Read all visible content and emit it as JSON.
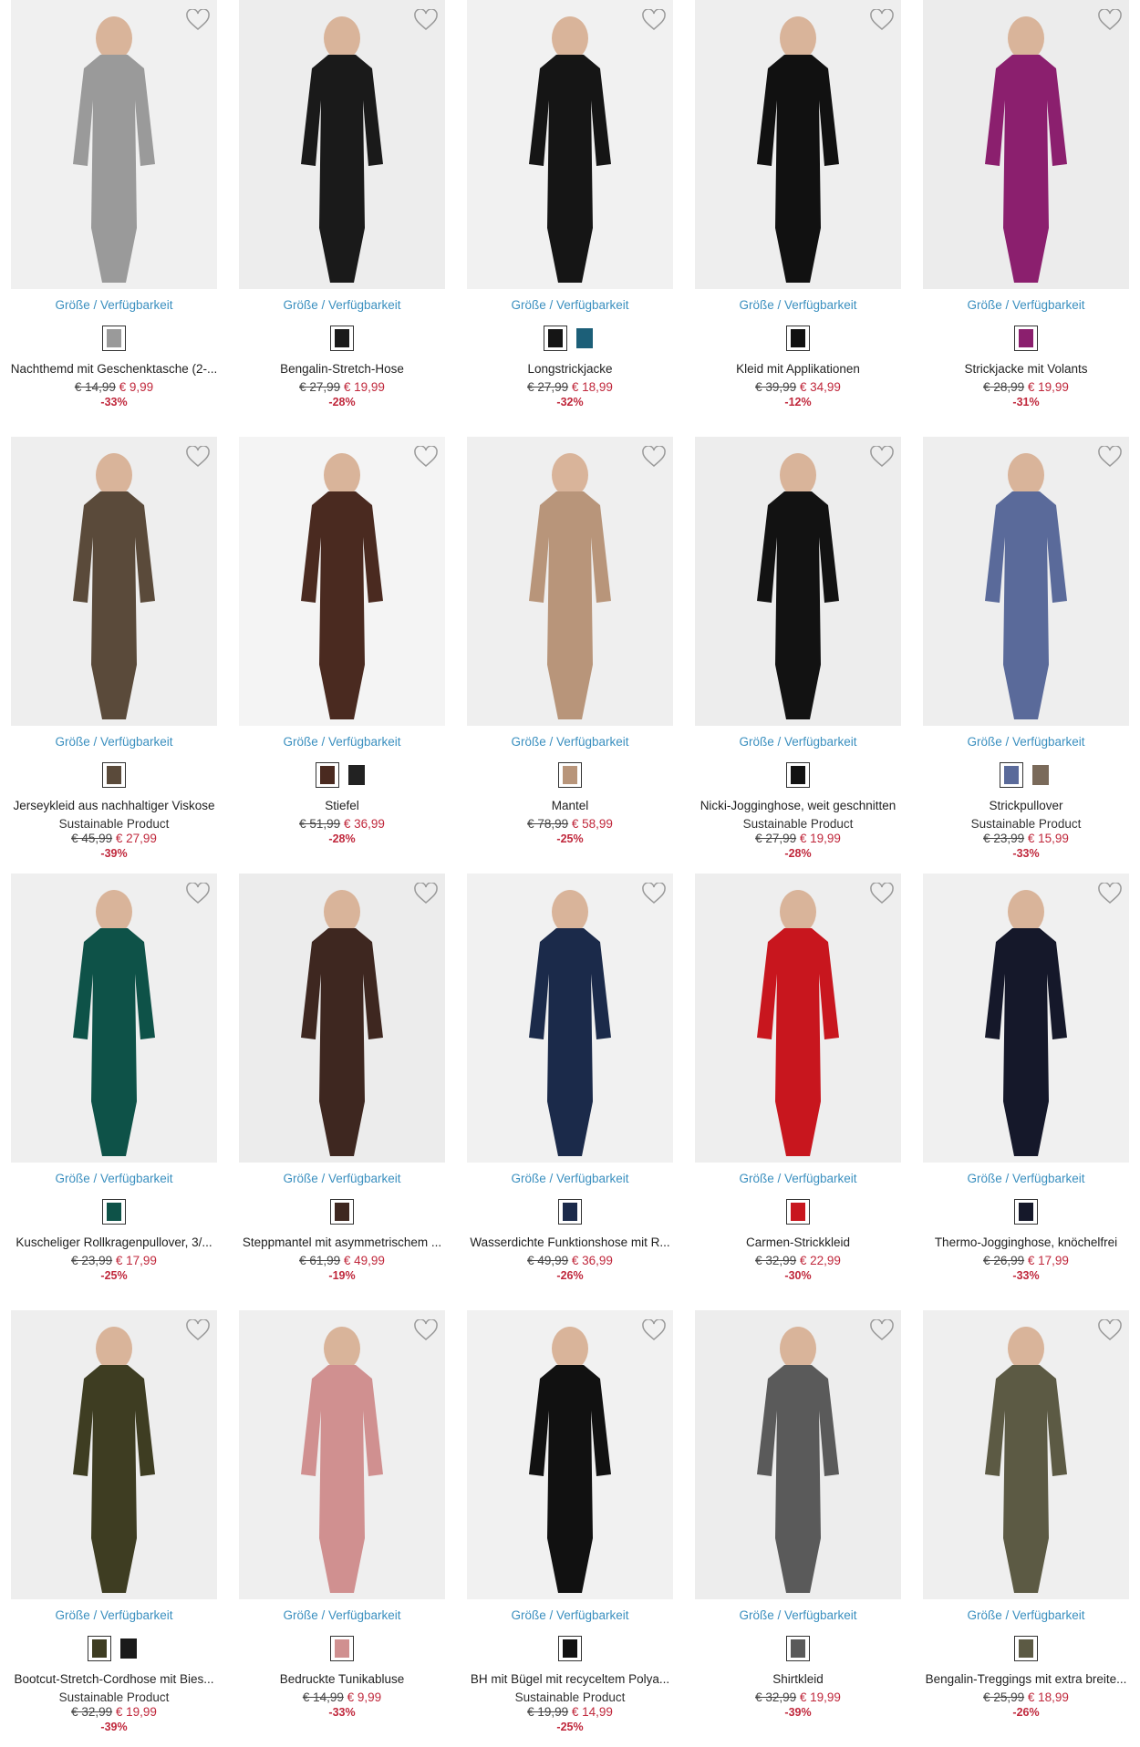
{
  "colors": {
    "link": "#3a8fbf",
    "sale": "#c0283c",
    "text": "#222222",
    "image_bg": "#efefef"
  },
  "common": {
    "size_link": "Größe / Verfügbarkeit",
    "wishlist_icon": "heart-outline-icon"
  },
  "products": [
    {
      "name": "Nachthemd mit Geschenktasche (2-...",
      "sustainable": "",
      "old_price": "€ 14,99",
      "new_price": "€ 9,99",
      "discount": "-33%",
      "image_bg": "#f0f0f0",
      "garment_color": "#9a9a9a",
      "swatches": [
        "#9a9a9a"
      ]
    },
    {
      "name": "Bengalin-Stretch-Hose",
      "sustainable": "",
      "old_price": "€ 27,99",
      "new_price": "€ 19,99",
      "discount": "-28%",
      "image_bg": "#ededed",
      "garment_color": "#1a1a1a",
      "swatches": [
        "#1a1a1a"
      ]
    },
    {
      "name": "Longstrickjacke",
      "sustainable": "",
      "old_price": "€ 27,99",
      "new_price": "€ 18,99",
      "discount": "-32%",
      "image_bg": "#f1f1f1",
      "garment_color": "#151515",
      "swatches": [
        "#151515",
        "#1c5f78"
      ]
    },
    {
      "name": "Kleid mit Applikationen",
      "sustainable": "",
      "old_price": "€ 39,99",
      "new_price": "€ 34,99",
      "discount": "-12%",
      "image_bg": "#eeeeee",
      "garment_color": "#111111",
      "swatches": [
        "#111111"
      ]
    },
    {
      "name": "Strickjacke mit Volants",
      "sustainable": "",
      "old_price": "€ 28,99",
      "new_price": "€ 19,99",
      "discount": "-31%",
      "image_bg": "#ececec",
      "garment_color": "#8b1f6e",
      "swatches": [
        "#8b1f6e"
      ]
    },
    {
      "name": "Jerseykleid aus nachhaltiger Viskose",
      "sustainable": "Sustainable Product",
      "old_price": "€ 45,99",
      "new_price": "€ 27,99",
      "discount": "-39%",
      "image_bg": "#eeeeee",
      "garment_color": "#5a4a3a",
      "swatches": [
        "#5a4a3a"
      ]
    },
    {
      "name": "Stiefel",
      "sustainable": "",
      "old_price": "€ 51,99",
      "new_price": "€ 36,99",
      "discount": "-28%",
      "image_bg": "#f4f4f4",
      "garment_color": "#4a2a20",
      "swatches": [
        "#4a2a20",
        "#222222"
      ]
    },
    {
      "name": "Mantel",
      "sustainable": "",
      "old_price": "€ 78,99",
      "new_price": "€ 58,99",
      "discount": "-25%",
      "image_bg": "#efefef",
      "garment_color": "#b8957a",
      "swatches": [
        "#b8957a"
      ]
    },
    {
      "name": "Nicki-Jogginghose, weit geschnitten",
      "sustainable": "Sustainable Product",
      "old_price": "€ 27,99",
      "new_price": "€ 19,99",
      "discount": "-28%",
      "image_bg": "#ededed",
      "garment_color": "#121212",
      "swatches": [
        "#121212"
      ]
    },
    {
      "name": "Strickpullover",
      "sustainable": "Sustainable Product",
      "old_price": "€ 23,99",
      "new_price": "€ 15,99",
      "discount": "-33%",
      "image_bg": "#eeeeee",
      "garment_color": "#5a6a9a",
      "swatches": [
        "#5a6a9a",
        "#7a6a5a"
      ]
    },
    {
      "name": "Kuscheliger Rollkragenpullover, 3/...",
      "sustainable": "",
      "old_price": "€ 23,99",
      "new_price": "€ 17,99",
      "discount": "-25%",
      "image_bg": "#efefef",
      "garment_color": "#0e5248",
      "swatches": [
        "#0e5248"
      ]
    },
    {
      "name": "Steppmantel mit asymmetrischem ...",
      "sustainable": "",
      "old_price": "€ 61,99",
      "new_price": "€ 49,99",
      "discount": "-19%",
      "image_bg": "#ececec",
      "garment_color": "#3e2720",
      "swatches": [
        "#3e2720"
      ]
    },
    {
      "name": "Wasserdichte Funktionshose mit R...",
      "sustainable": "",
      "old_price": "€ 49,99",
      "new_price": "€ 36,99",
      "discount": "-26%",
      "image_bg": "#f1f1f1",
      "garment_color": "#1b2a4a",
      "swatches": [
        "#1b2a4a"
      ]
    },
    {
      "name": "Carmen-Strickkleid",
      "sustainable": "",
      "old_price": "€ 32,99",
      "new_price": "€ 22,99",
      "discount": "-30%",
      "image_bg": "#eeeeee",
      "garment_color": "#c8161e",
      "swatches": [
        "#c8161e"
      ]
    },
    {
      "name": "Thermo-Jogginghose, knöchelfrei",
      "sustainable": "",
      "old_price": "€ 26,99",
      "new_price": "€ 17,99",
      "discount": "-33%",
      "image_bg": "#f0f0f0",
      "garment_color": "#15182a",
      "swatches": [
        "#15182a"
      ]
    },
    {
      "name": "Bootcut-Stretch-Cordhose mit Bies...",
      "sustainable": "Sustainable Product",
      "old_price": "€ 32,99",
      "new_price": "€ 19,99",
      "discount": "-39%",
      "image_bg": "#eeeeee",
      "garment_color": "#3e3d22",
      "swatches": [
        "#3e3d22",
        "#1a1a1a"
      ]
    },
    {
      "name": "Bedruckte Tunikabluse",
      "sustainable": "",
      "old_price": "€ 14,99",
      "new_price": "€ 9,99",
      "discount": "-33%",
      "image_bg": "#efefef",
      "garment_color": "#d09090",
      "swatches": [
        "#d09090"
      ]
    },
    {
      "name": "BH mit Bügel mit recyceltem Polya...",
      "sustainable": "Sustainable Product",
      "old_price": "€ 19,99",
      "new_price": "€ 14,99",
      "discount": "-25%",
      "image_bg": "#f1f1f1",
      "garment_color": "#111111",
      "swatches": [
        "#111111"
      ]
    },
    {
      "name": "Shirtkleid",
      "sustainable": "",
      "old_price": "€ 32,99",
      "new_price": "€ 19,99",
      "discount": "-39%",
      "image_bg": "#ededed",
      "garment_color": "#5a5a5a",
      "swatches": [
        "#5a5a5a"
      ]
    },
    {
      "name": "Bengalin-Treggings mit extra breite...",
      "sustainable": "",
      "old_price": "€ 25,99",
      "new_price": "€ 18,99",
      "discount": "-26%",
      "image_bg": "#efefef",
      "garment_color": "#5c5a44",
      "swatches": [
        "#5c5a44"
      ]
    }
  ]
}
